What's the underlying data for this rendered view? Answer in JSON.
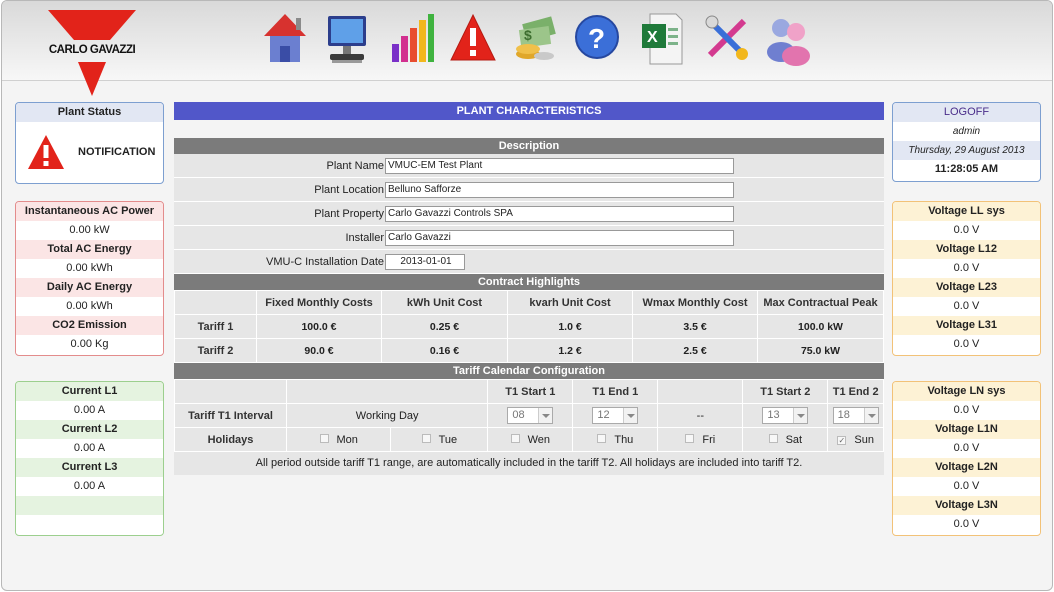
{
  "brand": {
    "name": "CARLO GAVAZZI",
    "color": "#e2231a"
  },
  "toolbar": [
    {
      "icon": "home-icon"
    },
    {
      "icon": "monitor-icon"
    },
    {
      "icon": "bar-chart-icon"
    },
    {
      "icon": "warning-icon"
    },
    {
      "icon": "money-icon"
    },
    {
      "icon": "help-icon"
    },
    {
      "icon": "excel-icon"
    },
    {
      "icon": "tools-icon"
    },
    {
      "icon": "users-icon"
    }
  ],
  "plant_status": {
    "title": "Plant Status",
    "notification": "NOTIFICATION"
  },
  "ac_power": [
    {
      "label": "Instantaneous AC Power",
      "value": "0.00 kW"
    },
    {
      "label": "Total AC Energy",
      "value": "0.00 kWh"
    },
    {
      "label": "Daily AC Energy",
      "value": "0.00 kWh"
    },
    {
      "label": "CO2 Emission",
      "value": "0.00 Kg"
    }
  ],
  "currents": [
    {
      "label": "Current L1",
      "value": "0.00 A"
    },
    {
      "label": "Current L2",
      "value": "0.00 A"
    },
    {
      "label": "Current L3",
      "value": "0.00 A"
    }
  ],
  "session": {
    "logoff": "LOGOFF",
    "user": "admin",
    "date": "Thursday, 29 August 2013",
    "time": "11:28:05 AM"
  },
  "voltage_ll": [
    {
      "label": "Voltage LL sys",
      "value": "0.0 V"
    },
    {
      "label": "Voltage L12",
      "value": "0.0 V"
    },
    {
      "label": "Voltage L23",
      "value": "0.0 V"
    },
    {
      "label": "Voltage L31",
      "value": "0.0 V"
    }
  ],
  "voltage_ln": [
    {
      "label": "Voltage LN sys",
      "value": "0.0 V"
    },
    {
      "label": "Voltage L1N",
      "value": "0.0 V"
    },
    {
      "label": "Voltage L2N",
      "value": "0.0 V"
    },
    {
      "label": "Voltage L3N",
      "value": "0.0 V"
    }
  ],
  "main": {
    "title": "PLANT CHARACTERISTICS",
    "description": {
      "title": "Description",
      "plant_name_label": "Plant Name",
      "plant_name": "VMUC-EM Test Plant",
      "plant_location_label": "Plant Location",
      "plant_location": "Belluno Safforze",
      "plant_property_label": "Plant Property",
      "plant_property": "Carlo Gavazzi Controls SPA",
      "installer_label": "Installer",
      "installer": "Carlo Gavazzi",
      "install_date_label": "VMU-C Installation Date",
      "install_date": "2013-01-01"
    },
    "contract": {
      "title": "Contract Highlights",
      "columns": [
        "Fixed Monthly Costs",
        "kWh Unit Cost",
        "kvarh Unit Cost",
        "Wmax Monthly Cost",
        "Max Contractual Peak"
      ],
      "rows": [
        {
          "label": "Tariff  1",
          "values": [
            "100.0 €",
            "0.25 €",
            "1.0 €",
            "3.5 €",
            "100.0 kW"
          ]
        },
        {
          "label": "Tariff  2",
          "values": [
            "90.0 €",
            "0.16 €",
            "1.2 €",
            "2.5 €",
            "75.0 kW"
          ]
        }
      ]
    },
    "tariff": {
      "title": "Tariff Calendar Configuration",
      "col_t1_start1": "T1 Start 1",
      "col_t1_end1": "T1 End 1",
      "col_t1_start2": "T1 Start 2",
      "col_t1_end2": "T1 End 2",
      "interval_label": "Tariff T1 Interval",
      "day_type": "Working Day",
      "start1": "08",
      "end1": "12",
      "separator": "--",
      "start2": "13",
      "end2": "18",
      "holidays_label": "Holidays",
      "days": [
        {
          "label": "Mon",
          "checked": false
        },
        {
          "label": "Tue",
          "checked": false
        },
        {
          "label": "Wen",
          "checked": false
        },
        {
          "label": "Thu",
          "checked": false
        },
        {
          "label": "Fri",
          "checked": false
        },
        {
          "label": "Sat",
          "checked": false
        },
        {
          "label": "Sun",
          "checked": true
        }
      ],
      "note": "All period outside tariff T1 range, are automatically included in the tariff T2. All holidays are included into tariff T2."
    }
  }
}
